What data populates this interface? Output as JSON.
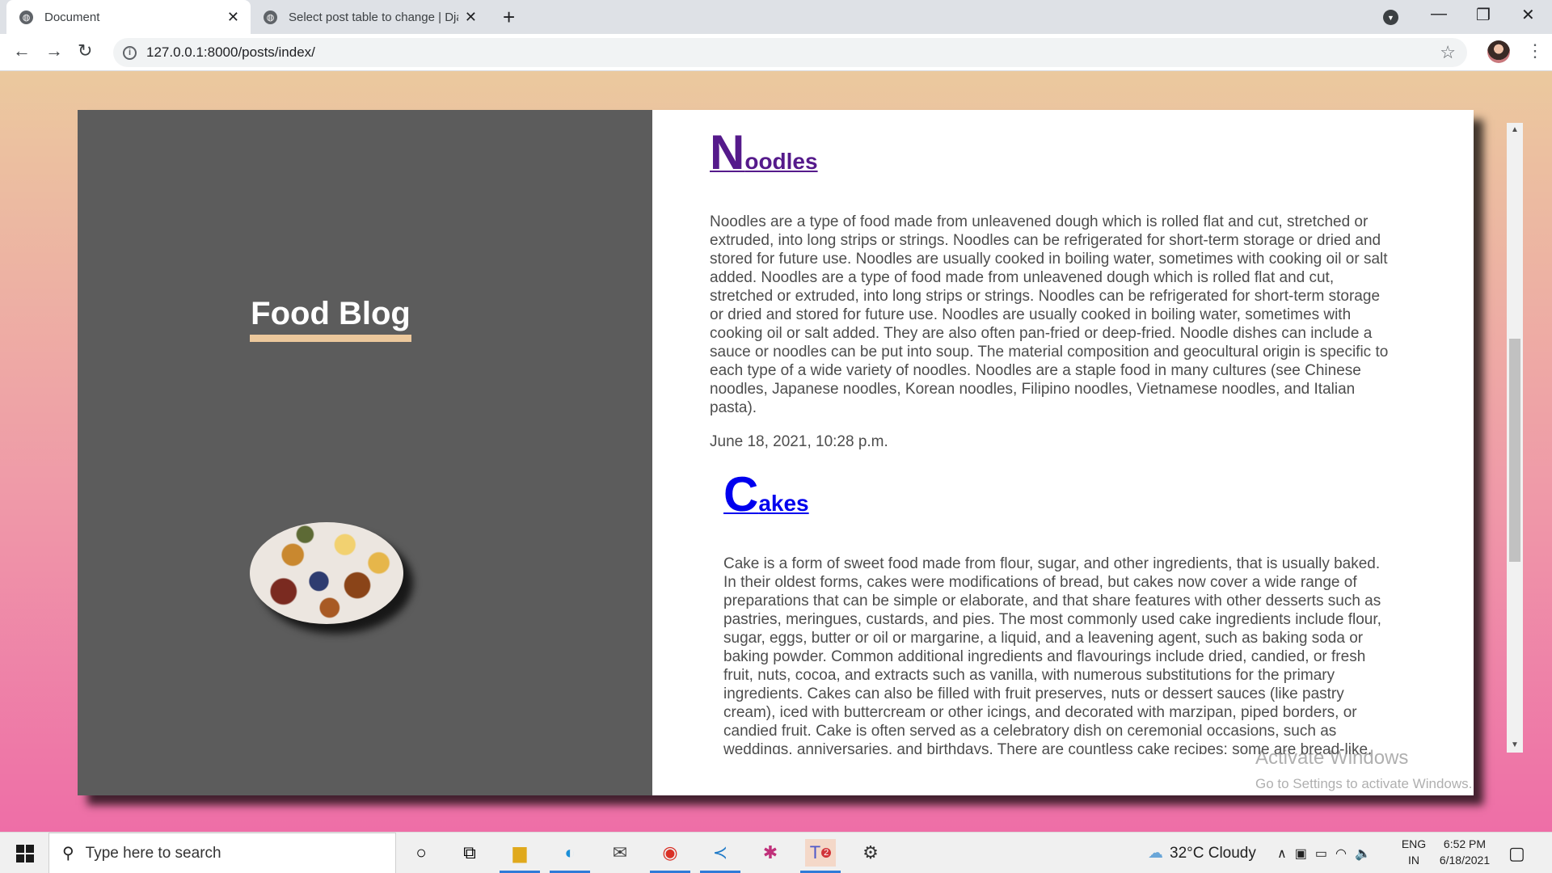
{
  "browser": {
    "tabs": [
      {
        "title": "Document",
        "active": true
      },
      {
        "title": "Select post table to change | Django",
        "active": false
      }
    ],
    "url": "127.0.0.1:8000/posts/index/"
  },
  "page": {
    "blog_title": "Food Blog",
    "posts": [
      {
        "title_initial": "N",
        "title_rest": "oodles",
        "title_color": "#551a8b",
        "body": "Noodles are a type of food made from unleavened dough which is rolled flat and cut, stretched or extruded, into long strips or strings. Noodles can be refrigerated for short-term storage or dried and stored for future use. Noodles are usually cooked in boiling water, sometimes with cooking oil or salt added. Noodles are a type of food made from unleavened dough which is rolled flat and cut, stretched or extruded, into long strips or strings. Noodles can be refrigerated for short-term storage or dried and stored for future use. Noodles are usually cooked in boiling water, sometimes with cooking oil or salt added. They are also often pan-fried or deep-fried. Noodle dishes can include a sauce or noodles can be put into soup. The material composition and geocultural origin is specific to each type of a wide variety of noodles. Noodles are a staple food in many cultures (see Chinese noodles, Japanese noodles, Korean noodles, Filipino noodles, Vietnamese noodles, and Italian pasta).",
        "date": "June 18, 2021, 10:28 p.m."
      },
      {
        "title_initial": "C",
        "title_rest": "akes",
        "title_color": "#0000ee",
        "body": "Cake is a form of sweet food made from flour, sugar, and other ingredients, that is usually baked. In their oldest forms, cakes were modifications of bread, but cakes now cover a wide range of preparations that can be simple or elaborate, and that share features with other desserts such as pastries, meringues, custards, and pies. The most commonly used cake ingredients include flour, sugar, eggs, butter or oil or margarine, a liquid, and a leavening agent, such as baking soda or baking powder. Common additional ingredients and flavourings include dried, candied, or fresh fruit, nuts, cocoa, and extracts such as vanilla, with numerous substitutions for the primary ingredients. Cakes can also be filled with fruit preserves, nuts or dessert sauces (like pastry cream), iced with buttercream or other icings, and decorated with marzipan, piped borders, or candied fruit. Cake is often served as a celebratory dish on ceremonial occasions, such as weddings, anniversaries, and birthdays. There are countless cake recipes; some are bread-like, some are rich and elaborate, and"
      }
    ],
    "watermark": {
      "heading": "Activate Windows",
      "subtext": "Go to Settings to activate Windows."
    }
  },
  "taskbar": {
    "search_placeholder": "Type here to search",
    "weather": "32°C  Cloudy",
    "lang_top": "ENG",
    "lang_bottom": "IN",
    "time": "6:52 PM",
    "date": "6/18/2021",
    "teams_badge": "2"
  },
  "colors": {
    "page_gradient_top": "#ebc99e",
    "page_gradient_bottom": "#ee6ea7",
    "left_panel": "#5c5c5c",
    "title_underline": "#ecc89c"
  }
}
